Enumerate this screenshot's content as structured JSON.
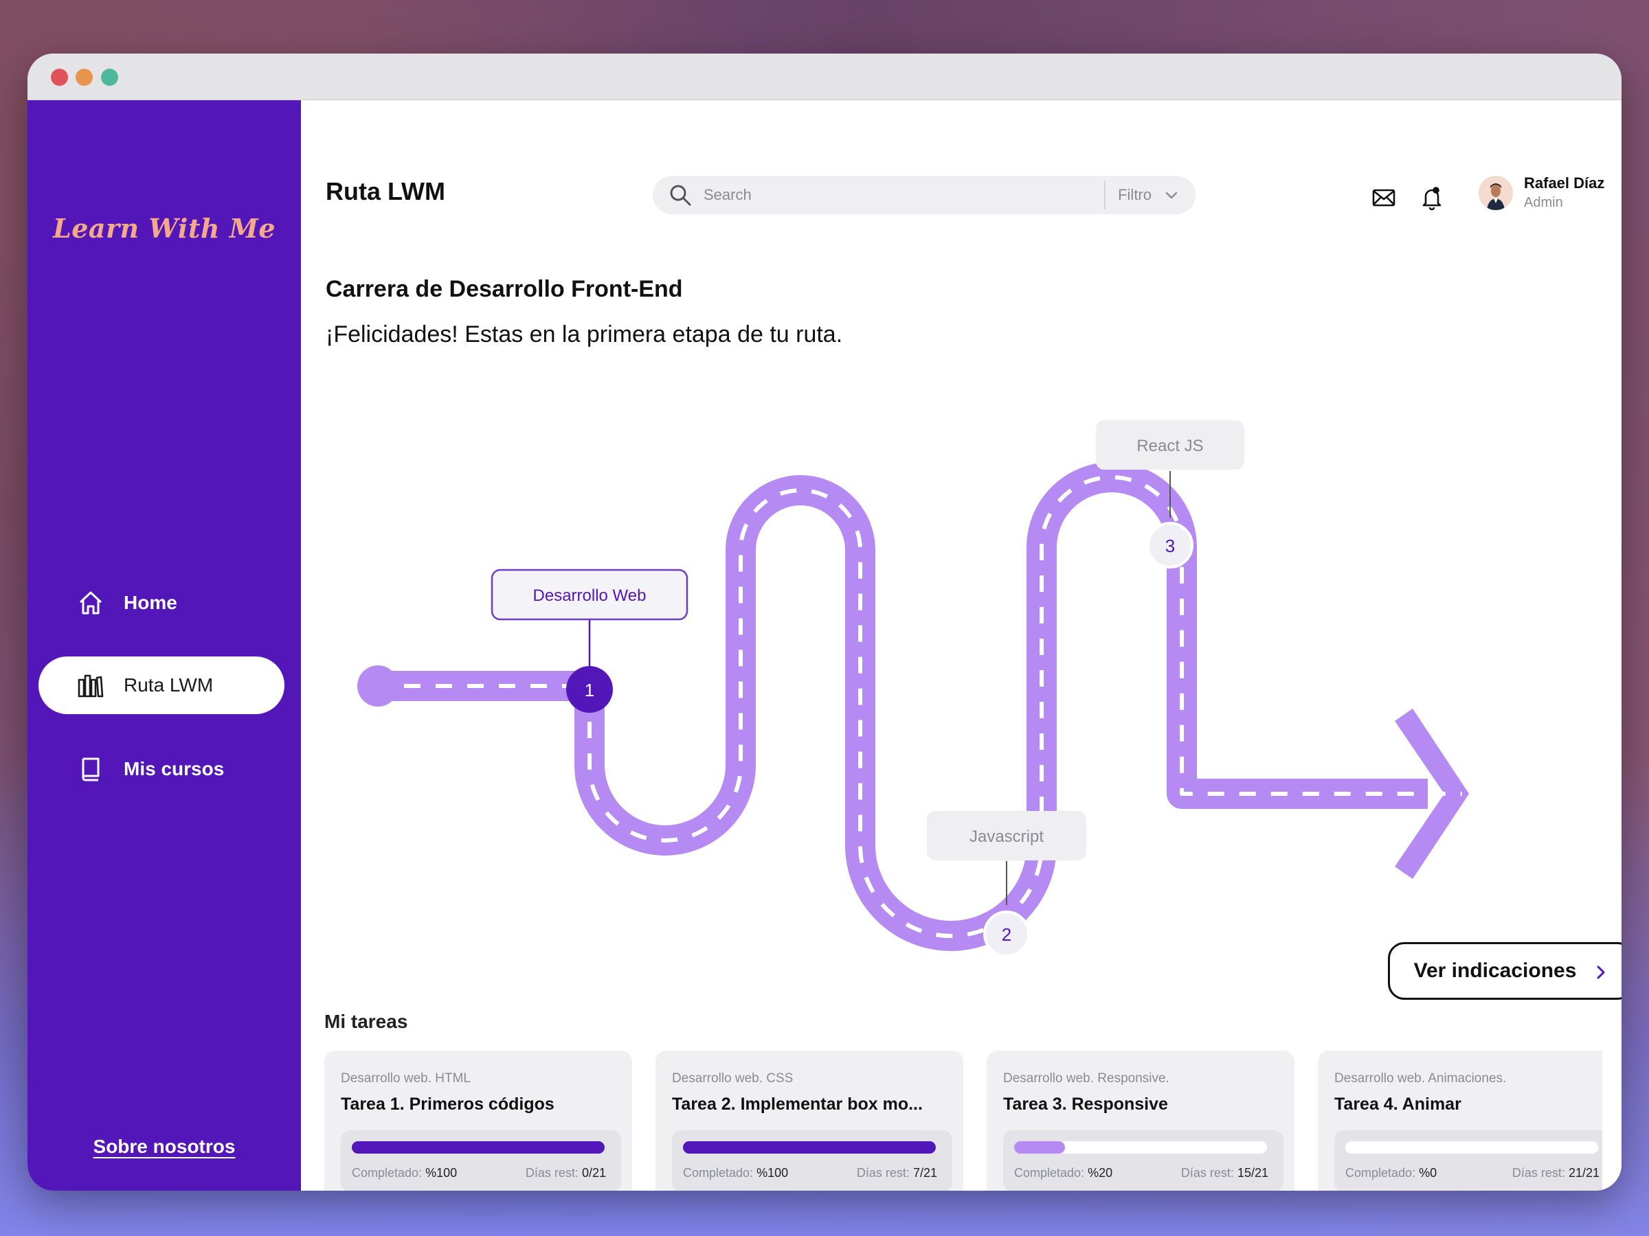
{
  "app": {
    "logo": "Learn With Me",
    "footer_link": "Sobre nosotros"
  },
  "sidebar": {
    "items": [
      {
        "label": "Home",
        "icon": "home-icon",
        "active": false
      },
      {
        "label": "Ruta LWM",
        "icon": "library-icon",
        "active": true
      },
      {
        "label": "Mis cursos",
        "icon": "book-icon",
        "active": false
      }
    ]
  },
  "header": {
    "title": "Ruta LWM",
    "search_placeholder": "Search",
    "filter_label": "Filtro",
    "user_name": "Rafael Díaz",
    "user_role": "Admin"
  },
  "content": {
    "heading": "Carrera de Desarrollo Front-End",
    "subheading": "¡Felicidades! Estas en la primera etapa de tu ruta."
  },
  "roadmap": {
    "milestones": [
      {
        "number": "1",
        "label": "Desarrollo Web",
        "state": "current"
      },
      {
        "number": "2",
        "label": "Javascript",
        "state": "pending"
      },
      {
        "number": "3",
        "label": "React JS",
        "state": "pending"
      }
    ],
    "cta_label": "Ver indicaciones"
  },
  "tasks": {
    "title": "Mi tareas",
    "completed_label": "Completado:",
    "days_label": "Días rest:",
    "items": [
      {
        "category": "Desarrollo web. HTML",
        "name": "Tarea 1. Primeros códigos",
        "completed": "%100",
        "progress": 1.0,
        "days": "0/21"
      },
      {
        "category": "Desarrollo web. CSS",
        "name": "Tarea 2. Implementar box mo...",
        "completed": "%100",
        "progress": 1.0,
        "days": "7/21"
      },
      {
        "category": "Desarrollo web. Responsive.",
        "name": "Tarea 3. Responsive",
        "completed": "%20",
        "progress": 0.2,
        "days": "15/21"
      },
      {
        "category": "Desarrollo web. Animaciones.",
        "name": "Tarea 4. Animar",
        "completed": "%0",
        "progress": 0.0,
        "days": "21/21"
      }
    ]
  },
  "colors": {
    "brand": "#5316b8",
    "path": "#b58bf3",
    "logo": "#f4a98a",
    "progress_full": "#5316b8",
    "progress_partial": "#b58bf3"
  }
}
